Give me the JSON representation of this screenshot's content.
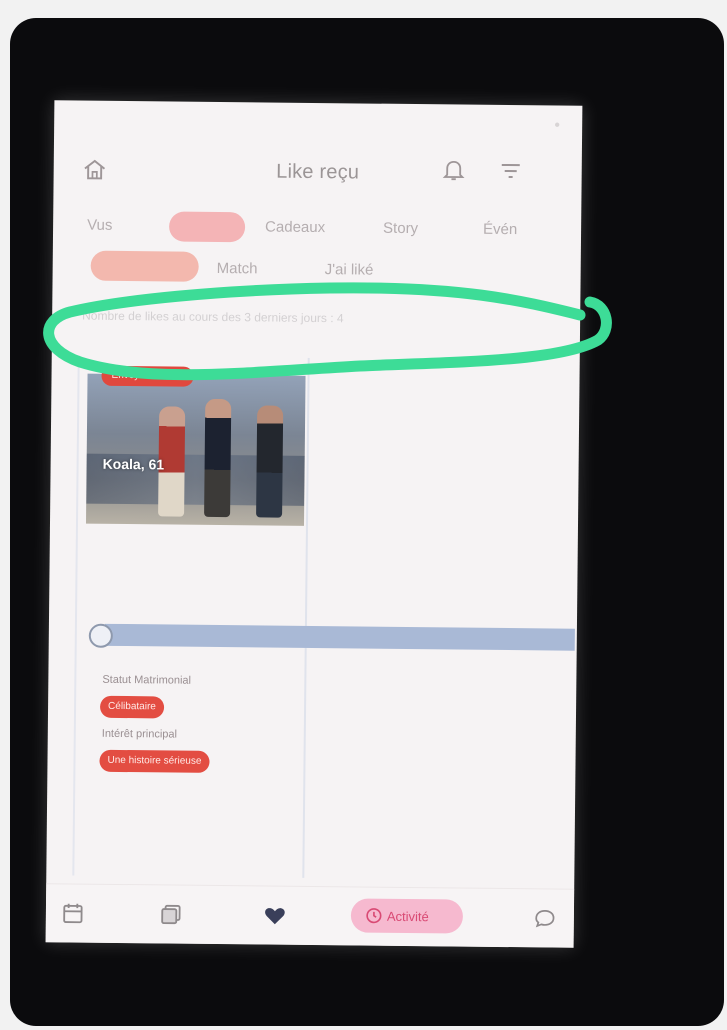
{
  "header": {
    "title": "Like reçu"
  },
  "tabs": [
    {
      "label": "Vus"
    },
    {
      "label": "Cadeaux"
    },
    {
      "label": "Story"
    },
    {
      "label": "Évén"
    }
  ],
  "subtabs": [
    {
      "label": "Match"
    },
    {
      "label": "J'ai liké"
    }
  ],
  "notice": "Nombre de likes au cours des 3 derniers jours : 4",
  "card": {
    "badge": "Envoyer cadeau",
    "name": "Koala, 61",
    "fields": [
      {
        "label": "Statut Matrimonial",
        "value": "Célibataire"
      },
      {
        "label": "Intérêt principal",
        "value": "Une histoire sérieuse"
      }
    ]
  },
  "bottom_nav": {
    "active_label": "Activité"
  },
  "colors": {
    "accent": "#e0483e",
    "marker": "#3ddc97",
    "active_pill": "#f6b9cf"
  },
  "icons": [
    "home-icon",
    "bell-icon",
    "filter-icon",
    "calendar-icon",
    "cards-icon",
    "heart-icon",
    "clock-icon",
    "chat-icon"
  ]
}
